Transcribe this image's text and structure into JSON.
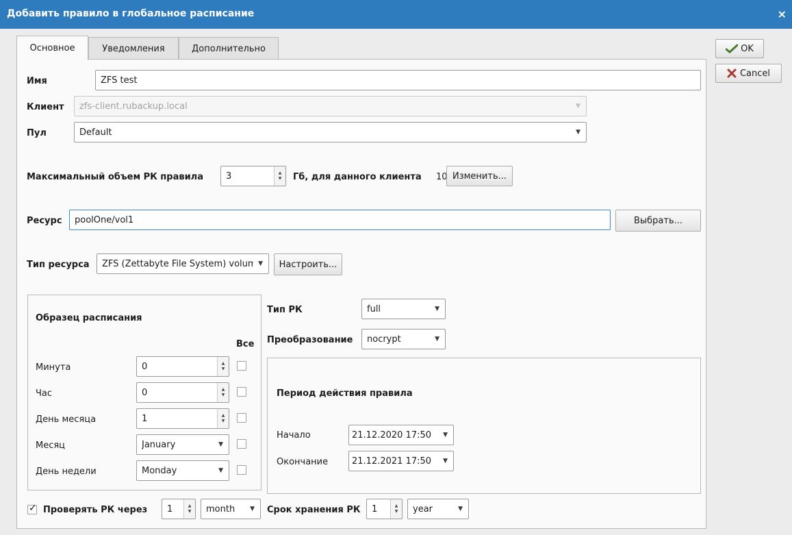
{
  "window": {
    "title": "Добавить правило в глобальное расписание",
    "close_glyph": "×"
  },
  "dialog_buttons": {
    "ok": "OK",
    "cancel": "Cancel"
  },
  "tabs": [
    {
      "label": "Основное",
      "active": true
    },
    {
      "label": "Уведомления",
      "active": false
    },
    {
      "label": "Дополнительно",
      "active": false
    }
  ],
  "form": {
    "name_label": "Имя",
    "name_value": "ZFS test",
    "client_label": "Клиент",
    "client_value": "zfs-client.rubackup.local",
    "pool_label": "Пул",
    "pool_value": "Default",
    "max_volume_label": "Максимальный объем РК правила",
    "max_volume_value": "3",
    "max_volume_unit": "Гб, для данного клиента",
    "max_volume_client_value": "10",
    "change_button": "Изменить...",
    "resource_label": "Ресурс",
    "resource_value": "poolOne/vol1",
    "choose_button": "Выбрать...",
    "resource_type_label": "Тип ресурса",
    "resource_type_value": "ZFS (Zettabyte File System) volume",
    "configure_button": "Настроить..."
  },
  "schedule": {
    "title": "Образец расписания",
    "all_label": "Все",
    "rows": [
      {
        "label": "Минута",
        "value": "0",
        "kind": "spin"
      },
      {
        "label": "Час",
        "value": "0",
        "kind": "spin"
      },
      {
        "label": "День месяца",
        "value": "1",
        "kind": "spin"
      },
      {
        "label": "Месяц",
        "value": "January",
        "kind": "combo"
      },
      {
        "label": "День недели",
        "value": "Monday",
        "kind": "combo"
      }
    ]
  },
  "backup": {
    "type_label": "Тип РК",
    "type_value": "full",
    "transform_label": "Преобразование",
    "transform_value": "nocrypt"
  },
  "period": {
    "title": "Период действия правила",
    "start_label": "Начало",
    "start_value": "21.12.2020 17:50",
    "end_label": "Окончание",
    "end_value": "21.12.2021 17:50"
  },
  "footer": {
    "verify_label": "Проверять РК через",
    "verify_checked": true,
    "verify_value": "1",
    "verify_unit": "month",
    "retention_label": "Срок хранения РК",
    "retention_value": "1",
    "retention_unit": "year"
  },
  "colors": {
    "titlebar": "#2e7bbd",
    "focus_border": "#3b8ad1"
  },
  "icons": {
    "ok": "ok-check-icon",
    "cancel": "cancel-x-icon",
    "dropdown": "chevron-down-icon"
  }
}
